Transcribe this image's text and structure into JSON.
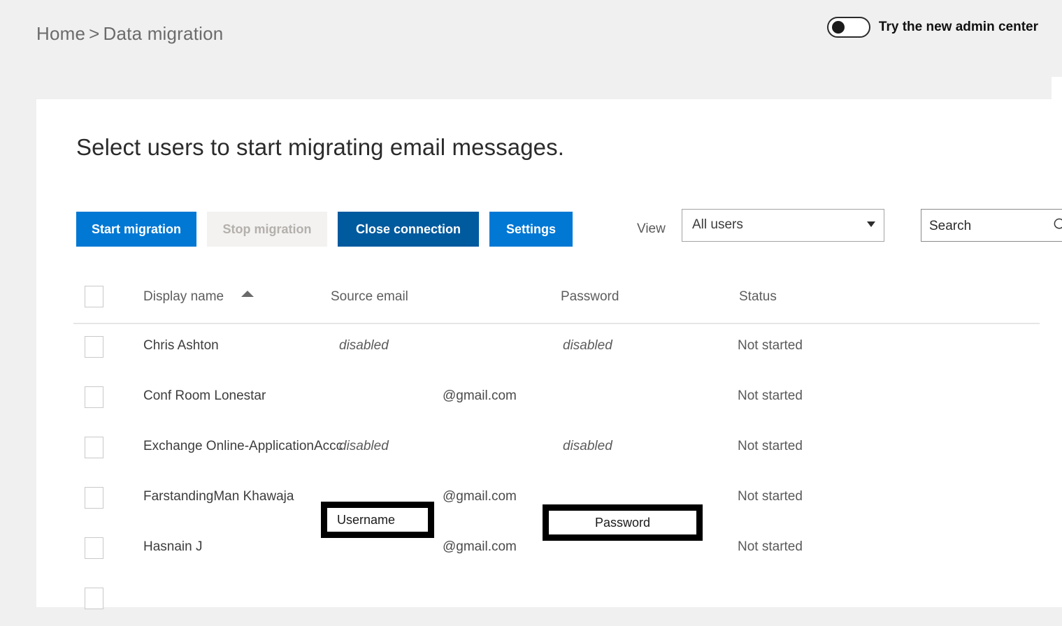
{
  "breadcrumb": {
    "home": "Home",
    "separator": ">",
    "current": "Data migration"
  },
  "header": {
    "admin_toggle_label": "Try the new admin center",
    "admin_toggle_state": "off"
  },
  "page": {
    "title": "Select users to start migrating email messages."
  },
  "toolbar": {
    "start_label": "Start migration",
    "stop_label": "Stop migration",
    "close_label": "Close connection",
    "settings_label": "Settings",
    "view_label": "View",
    "view_value": "All users",
    "search_placeholder": "Search",
    "search_value": ""
  },
  "table": {
    "columns": {
      "display_name": "Display name",
      "source_email": "Source email",
      "password": "Password",
      "status": "Status"
    },
    "sort": {
      "column": "Display name",
      "direction": "ascending"
    },
    "rows": [
      {
        "display_name": "Chris Ashton",
        "source_email": "disabled",
        "source_email_style": "italic",
        "password": "disabled",
        "password_style": "italic",
        "status": "Not started"
      },
      {
        "display_name": "Conf Room Lonestar",
        "source_email": "@gmail.com",
        "source_email_style": "normal",
        "password": "",
        "password_style": "normal",
        "status": "Not started"
      },
      {
        "display_name": "Exchange Online-ApplicationAccc",
        "source_email": "disabled",
        "source_email_style": "italic",
        "password": "disabled",
        "password_style": "italic",
        "status": "Not started"
      },
      {
        "display_name": "FarstandingMan Khawaja",
        "source_email": "@gmail.com",
        "source_email_style": "normal",
        "password": "",
        "password_style": "normal",
        "status": "Not started"
      },
      {
        "display_name": "Hasnain J",
        "source_email": "@gmail.com",
        "source_email_style": "normal",
        "password": "",
        "password_style": "normal",
        "status": "Not started"
      }
    ]
  },
  "annotations": {
    "username_box": "Username",
    "password_box": "Password"
  },
  "colors": {
    "primary_blue": "#0078d4",
    "dark_blue": "#005a9e",
    "disabled_gray": "#f3f2f1",
    "page_bg": "#f0f0f0",
    "panel_bg": "#ffffff"
  }
}
